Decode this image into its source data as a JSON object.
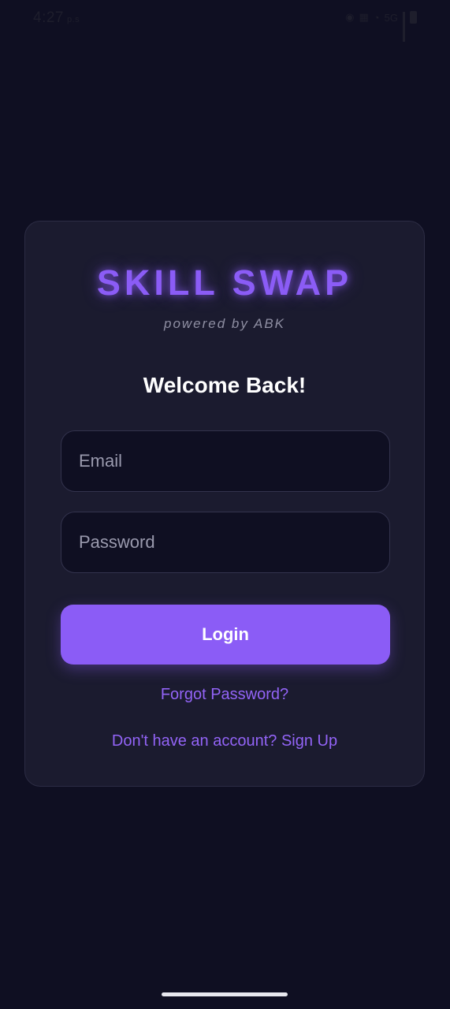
{
  "status_bar": {
    "time": "4:27",
    "time_suffix": "p.s",
    "network": "5G"
  },
  "brand": {
    "title": "SKILL SWAP",
    "subtitle": "powered by ABK"
  },
  "form": {
    "heading": "Welcome Back!",
    "email_placeholder": "Email",
    "password_placeholder": "Password",
    "login_label": "Login",
    "forgot_label": "Forgot Password?",
    "signup_label": "Don't have an account? Sign Up"
  },
  "colors": {
    "background": "#0f0f22",
    "card": "#1b1b2f",
    "accent": "#8b5cf6"
  }
}
